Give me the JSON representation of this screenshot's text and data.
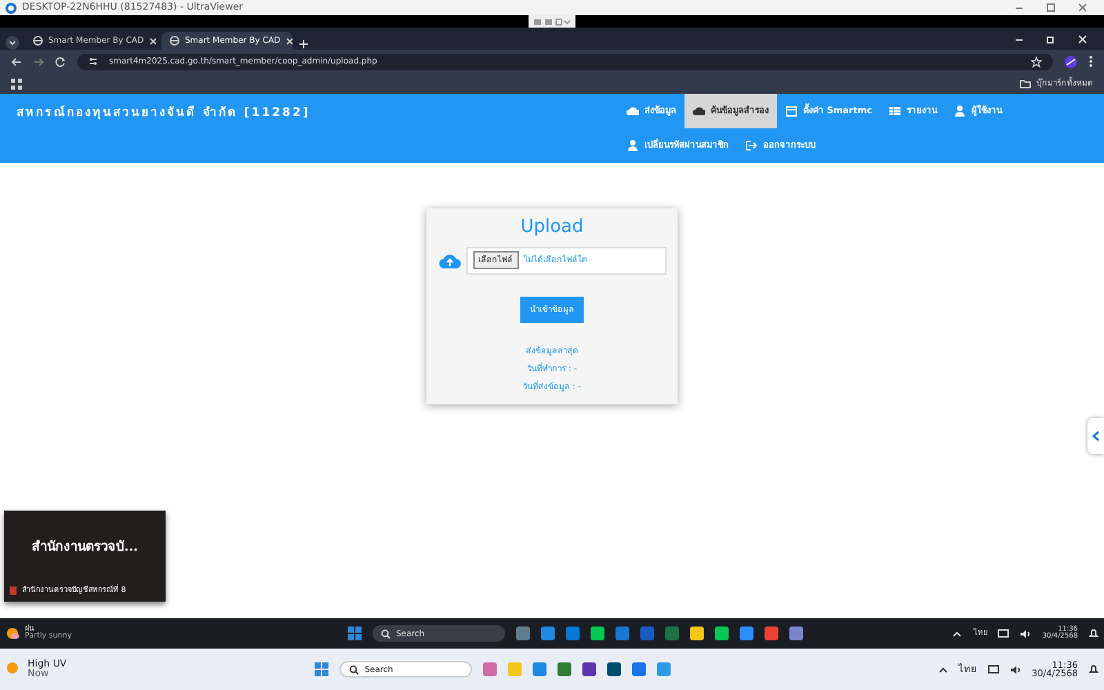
{
  "remote_window": {
    "title": "DESKTOP-22N6HHU (81527483) - UltraViewer"
  },
  "browser": {
    "tabs": [
      {
        "label": "Smart Member By CAD",
        "selected": false
      },
      {
        "label": "Smart Member By CAD",
        "selected": true
      }
    ],
    "address": "smart4m2025.cad.go.th/smart_member/coop_admin/upload.php",
    "bookmarks_label": "บุ๊กมาร์กทั้งหมด"
  },
  "navbar": {
    "brand": "สหกรณ์กองทุนสวนยางจันดี จำกัด [11282]",
    "items": [
      {
        "label": "ส่งข้อมูล",
        "selected": false
      },
      {
        "label": "ค้นข้อมูลสำรอง",
        "selected": true
      },
      {
        "label": "ตั้งค่า Smartmc",
        "selected": false
      },
      {
        "label": "รายงาน",
        "selected": false
      },
      {
        "label": "ผู้ใช้งาน",
        "selected": false
      },
      {
        "label": "เปลี่ยนรหัสผ่านสมาชิก",
        "selected": false
      },
      {
        "label": "ออกจากระบบ",
        "selected": false
      }
    ]
  },
  "upload": {
    "title": "Upload",
    "file_button": "เลือกไฟล์",
    "file_status": "ไม่ได้เลือกไฟล์ใด",
    "submit": "นำเข้าข้อมูล",
    "info": [
      "ส่งข้อมูลล่าสุด",
      "วันที่ทำการ : -",
      "วันที่ส่งข้อมูล : -"
    ]
  },
  "popup": {
    "heading": "สำนักงานตรวจบั...",
    "caption": "สำนักงานตรวจบัญชีสหกรณ์ที่ 8"
  },
  "inner_taskbar": {
    "weather_title": "ฝน",
    "weather": "Partly sunny",
    "search": "Search",
    "language": "ไทย",
    "time": "11:36",
    "date": "30/4/2568"
  },
  "outer_taskbar": {
    "weather_title": "High UV",
    "weather": "Now",
    "search": "Search",
    "language": "ไทย",
    "time": "11:36",
    "date": "30/4/2568"
  }
}
